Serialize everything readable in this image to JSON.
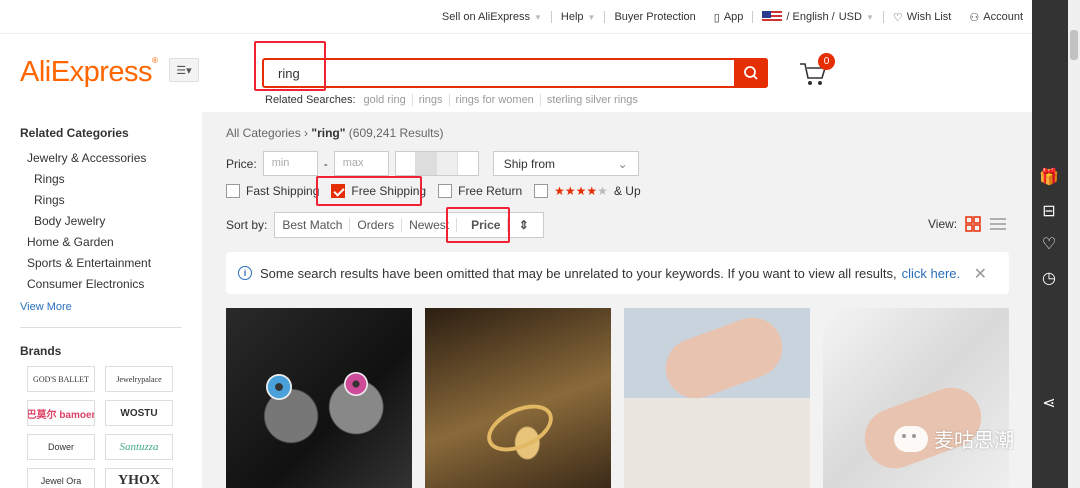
{
  "colors": {
    "accent": "#e62e04",
    "link": "#2a6ebb",
    "logo": "#f60"
  },
  "topnav": {
    "sell": "Sell on AliExpress",
    "help": "Help",
    "protection": "Buyer Protection",
    "app": "App",
    "lang": "/ English / ",
    "currency": "USD",
    "wishlist": "Wish List",
    "account": "Account"
  },
  "header": {
    "logo": "AliExpress",
    "search_value": "ring",
    "cart_count": "0",
    "related_label": "Related Searches:",
    "related": [
      "gold ring",
      "rings",
      "rings for women",
      "sterling silver rings"
    ]
  },
  "sidebar": {
    "related_title": "Related Categories",
    "categories": [
      {
        "label": "Jewelry & Accessories",
        "level": 1
      },
      {
        "label": "Rings",
        "level": 2
      },
      {
        "label": "Rings",
        "level": 2
      },
      {
        "label": "Body Jewelry",
        "level": 2
      },
      {
        "label": "Home & Garden",
        "level": 1
      },
      {
        "label": "Sports & Entertainment",
        "level": 1
      },
      {
        "label": "Consumer Electronics",
        "level": 1
      }
    ],
    "view_more": "View More",
    "brands_title": "Brands",
    "brands": [
      "GOD'S BALLET",
      "Jewelrypalace",
      "巴莫尔 bamoer",
      "WOSTU",
      "Dower",
      "Santuzza",
      "Jewel Ora",
      "YHOX"
    ]
  },
  "filters": {
    "breadcrumb_root": "All Categories",
    "query": "\"ring\"",
    "results": "(609,241 Results)",
    "price_label": "Price:",
    "min_placeholder": "min",
    "max_placeholder": "max",
    "ship_from": "Ship from",
    "checks": [
      "Fast Shipping",
      "Free Shipping",
      "Free Return"
    ],
    "stars_suffix": "& Up",
    "sort_label": "Sort by:",
    "sort_options": [
      "Best Match",
      "Orders",
      "Newest"
    ],
    "sort_price": "Price",
    "view_label": "View:"
  },
  "notice": {
    "text": "Some search results have been omitted that may be unrelated to your keywords. If you want to view all results,",
    "link": "click here."
  },
  "watermark": "麦咕思潮"
}
